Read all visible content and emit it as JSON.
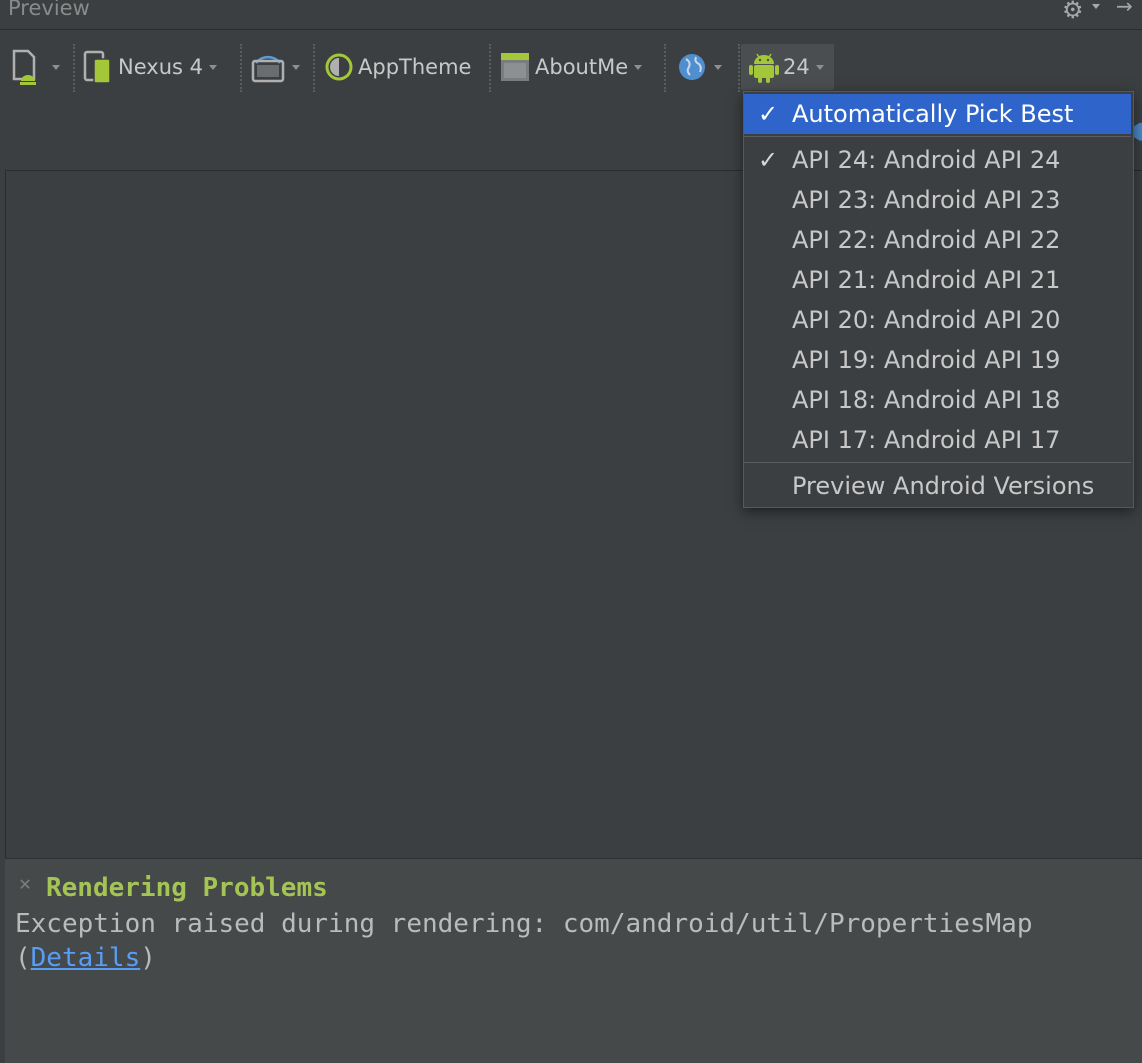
{
  "window": {
    "title": "Preview"
  },
  "toolbar": {
    "device": {
      "label": "Nexus 4"
    },
    "theme": {
      "label": "AppTheme"
    },
    "activity": {
      "label": "AboutMe"
    },
    "api": {
      "label": "24"
    }
  },
  "api_menu": {
    "items": [
      {
        "label": "Automatically Pick Best",
        "checked": true,
        "selected": true
      },
      {
        "label": "API 24: Android API 24",
        "checked": true
      },
      {
        "label": "API 23: Android API 23"
      },
      {
        "label": "API 22: Android API 22"
      },
      {
        "label": "API 21: Android API 21"
      },
      {
        "label": "API 20: Android API 20"
      },
      {
        "label": "API 19: Android API 19"
      },
      {
        "label": "API 18: Android API 18"
      },
      {
        "label": "API 17: Android API 17"
      },
      {
        "label": "Preview Android Versions"
      }
    ]
  },
  "problems": {
    "title": "Rendering Problems",
    "message": "Exception raised during rendering: com/android/util/PropertiesMap",
    "open_paren": "(",
    "details_link": "Details",
    "close_paren": ")"
  },
  "colors": {
    "background": "#3c3f41",
    "accent_selected": "#2f65ca",
    "android_green": "#a4c639",
    "problem_title": "#a4c454",
    "link": "#589df6"
  }
}
